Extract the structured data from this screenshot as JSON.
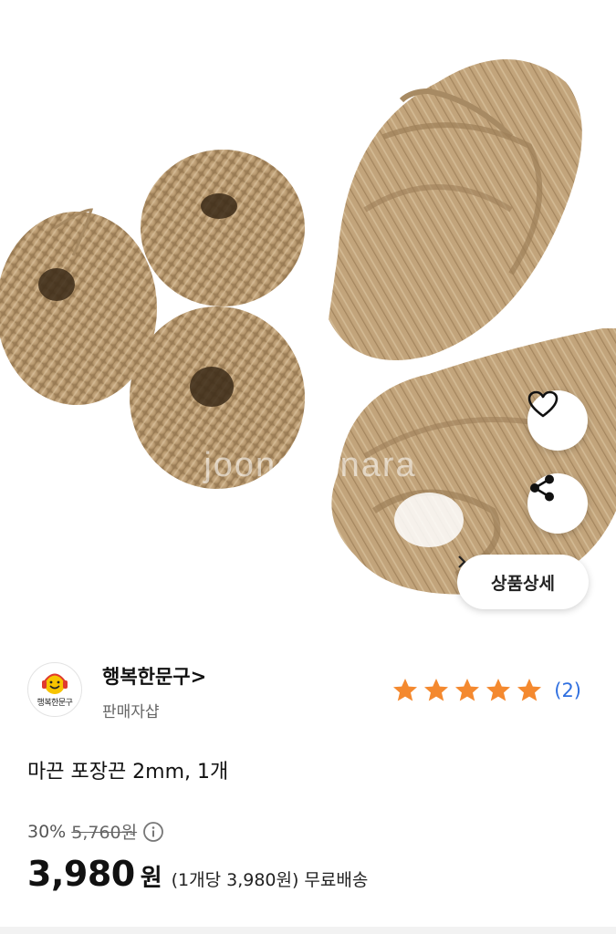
{
  "product_image": {
    "alt": "jute twine rolls",
    "watermark": "joonggonara"
  },
  "actions": {
    "favorite_icon": "heart-outline-icon",
    "share_icon": "share-icon",
    "detail_label": "상품상세",
    "detail_chevron": "›"
  },
  "seller": {
    "logo_text": "행복한문구",
    "name": "행복한문구",
    "name_chevron": ">",
    "type": "판매자샵",
    "rating_stars": 5,
    "review_count": "(2)",
    "star_color": "#f4892f"
  },
  "product": {
    "title": "마끈 포장끈 2mm, 1개"
  },
  "price": {
    "discount": "30%",
    "original": "5,760원",
    "info_icon": "info-circle-icon",
    "sale_amount": "3,980",
    "sale_unit": "원",
    "unit_price": "(1개당 3,980원)",
    "shipping": "무료배송"
  }
}
